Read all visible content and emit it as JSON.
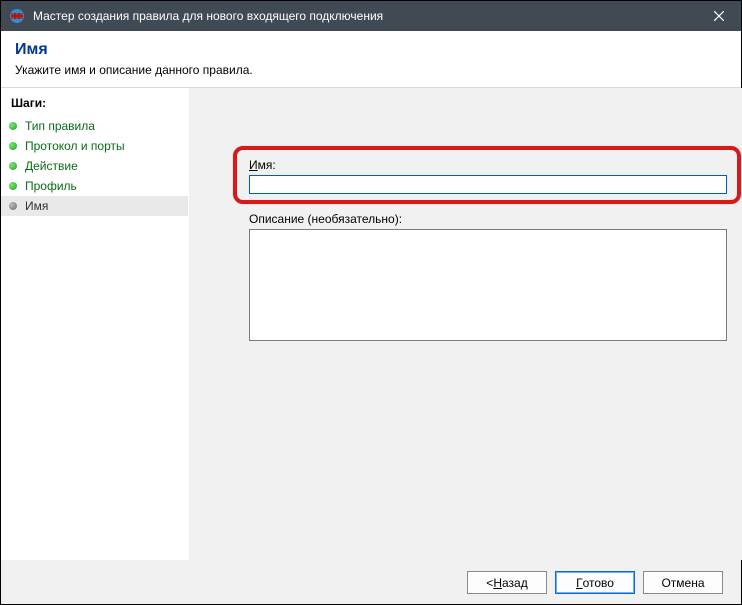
{
  "window": {
    "title": "Мастер создания правила для нового входящего подключения"
  },
  "header": {
    "title": "Имя",
    "subtitle": "Укажите имя и описание данного правила."
  },
  "sidebar": {
    "caption": "Шаги:",
    "items": [
      {
        "label": "Тип правила"
      },
      {
        "label": "Протокол и порты"
      },
      {
        "label": "Действие"
      },
      {
        "label": "Профиль"
      },
      {
        "label": "Имя"
      }
    ]
  },
  "form": {
    "name_label_prefix": "И",
    "name_label_rest": "мя:",
    "name_value": "",
    "desc_label": "Описание (необязательно):",
    "desc_value": ""
  },
  "buttons": {
    "back_prefix": "< ",
    "back_accel": "Н",
    "back_rest": "азад",
    "finish_accel": "Г",
    "finish_rest": "отово",
    "cancel": "Отмена"
  }
}
